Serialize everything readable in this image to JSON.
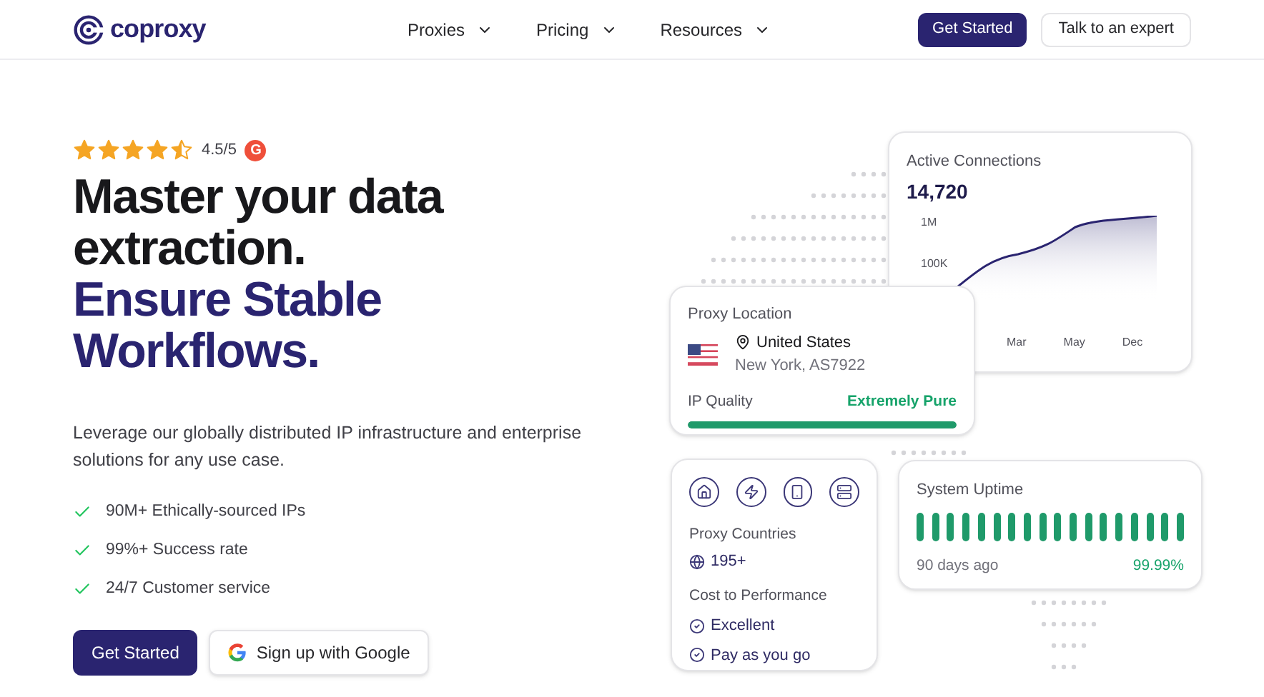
{
  "header": {
    "logo": "coproxy",
    "nav": [
      {
        "label": "Proxies"
      },
      {
        "label": "Pricing"
      },
      {
        "label": "Resources"
      }
    ],
    "primary_button": "Get Started",
    "secondary_button": "Talk to an expert"
  },
  "hero": {
    "rating": {
      "stars": 4.5,
      "score": "4.5/5",
      "badge": "G"
    },
    "headline": [
      "Master your data",
      "extraction."
    ],
    "headline_accent": [
      "Ensure Stable",
      "Workflows."
    ],
    "description": "Leverage our globally distributed IP infrastructure and enterprise solutions for any use case.",
    "features": [
      "90M+ Ethically-sourced IPs",
      "99%+ Success rate",
      "24/7 Customer service"
    ],
    "primary_button": "Get Started",
    "google_button": "Sign up with Google"
  },
  "connections_card": {
    "title": "Active Connections",
    "value": "14,720",
    "y_labels": [
      "1M",
      "100K"
    ],
    "x_labels": [
      "Mar",
      "May",
      "Dec"
    ]
  },
  "location_card": {
    "title": "Proxy Location",
    "country": "United States",
    "detail": "New York, AS7922",
    "quality_label": "IP Quality",
    "quality_value": "Extremely Pure",
    "level": 1
  },
  "features_card": {
    "countries_label": "Proxy Countries",
    "countries_value": "195+",
    "cost_label": "Cost to Performance",
    "cost_items": [
      "Excellent",
      "Pay as you go"
    ]
  },
  "uptime_card": {
    "title": "System Uptime",
    "since": "90 days ago",
    "value": "99.99%",
    "bars": [
      {
        "up": true
      },
      {
        "up": true
      },
      {
        "up": true
      },
      {
        "up": true
      },
      {
        "up": true
      },
      {
        "up": true
      },
      {
        "up": true
      },
      {
        "up": true
      },
      {
        "up": true
      },
      {
        "up": true
      },
      {
        "up": true
      },
      {
        "up": true
      },
      {
        "up": true
      },
      {
        "up": true
      },
      {
        "up": true
      },
      {
        "up": true
      },
      {
        "up": true
      },
      {
        "up": true
      }
    ]
  }
}
